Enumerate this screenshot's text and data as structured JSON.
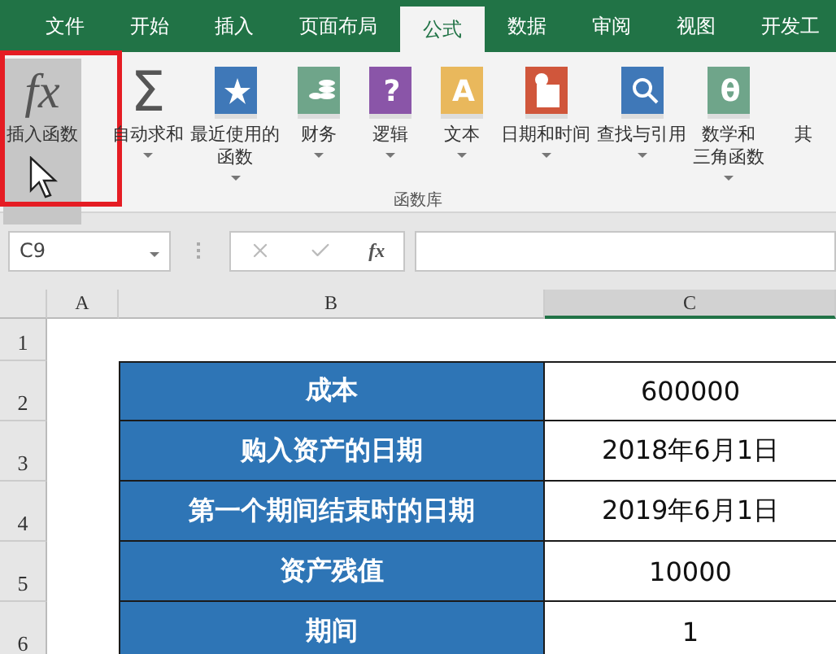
{
  "tabs": [
    {
      "label": "文件",
      "selected": false
    },
    {
      "label": "开始",
      "selected": false
    },
    {
      "label": "插入",
      "selected": false
    },
    {
      "label": "页面布局",
      "selected": false
    },
    {
      "label": "公式",
      "selected": true
    },
    {
      "label": "数据",
      "selected": false
    },
    {
      "label": "审阅",
      "selected": false
    },
    {
      "label": "视图",
      "selected": false
    },
    {
      "label": "开发工",
      "selected": false
    }
  ],
  "ribbon": {
    "group_label": "函数库",
    "buttons": [
      {
        "kind": "fx",
        "glyph": "fx",
        "lines": [
          "插入函数"
        ],
        "caret": false,
        "hovered": true,
        "highlighted": true
      },
      {
        "kind": "sigma",
        "glyph": "Σ",
        "lines": [
          "自动求和"
        ],
        "caret": true,
        "hovered": false
      },
      {
        "kind": "star",
        "color": "#3f78b8",
        "lines": [
          "最近使用的",
          "函数"
        ],
        "caret": true,
        "hovered": false
      },
      {
        "kind": "coins",
        "color": "#6fa58a",
        "lines": [
          "财务"
        ],
        "caret": true,
        "hovered": false
      },
      {
        "kind": "glyph",
        "glyph": "?",
        "color": "#8a55a8",
        "lines": [
          "逻辑"
        ],
        "caret": true,
        "hovered": false
      },
      {
        "kind": "glyph",
        "glyph": "A",
        "color": "#e9b85c",
        "lines": [
          "文本"
        ],
        "caret": true,
        "hovered": false
      },
      {
        "kind": "calendar",
        "color": "#d0563b",
        "lines": [
          "日期和时间"
        ],
        "caret": true,
        "hovered": false
      },
      {
        "kind": "search",
        "color": "#3f78b8",
        "lines": [
          "查找与引用"
        ],
        "caret": true,
        "hovered": false
      },
      {
        "kind": "glyph",
        "glyph": "θ",
        "color": "#6fa58a",
        "lines": [
          "数学和",
          "三角函数"
        ],
        "caret": true,
        "hovered": false
      },
      {
        "kind": "partial",
        "lines": [
          "其"
        ],
        "caret": false,
        "hovered": false
      }
    ]
  },
  "formula_bar": {
    "name_box": "C9",
    "fx": "fx"
  },
  "columns": [
    {
      "label": "A",
      "selected": false
    },
    {
      "label": "B",
      "selected": false
    },
    {
      "label": "C",
      "selected": true
    }
  ],
  "rows": [
    {
      "number": "1",
      "label": "",
      "value": ""
    },
    {
      "number": "2",
      "label": "成本",
      "value": "600000"
    },
    {
      "number": "3",
      "label": "购入资产的日期",
      "value": "2018年6月1日"
    },
    {
      "number": "4",
      "label": "第一个期间结束时的日期",
      "value": "2019年6月1日"
    },
    {
      "number": "5",
      "label": "资产残值",
      "value": "10000"
    },
    {
      "number": "6",
      "label": "期间",
      "value": "1"
    }
  ]
}
